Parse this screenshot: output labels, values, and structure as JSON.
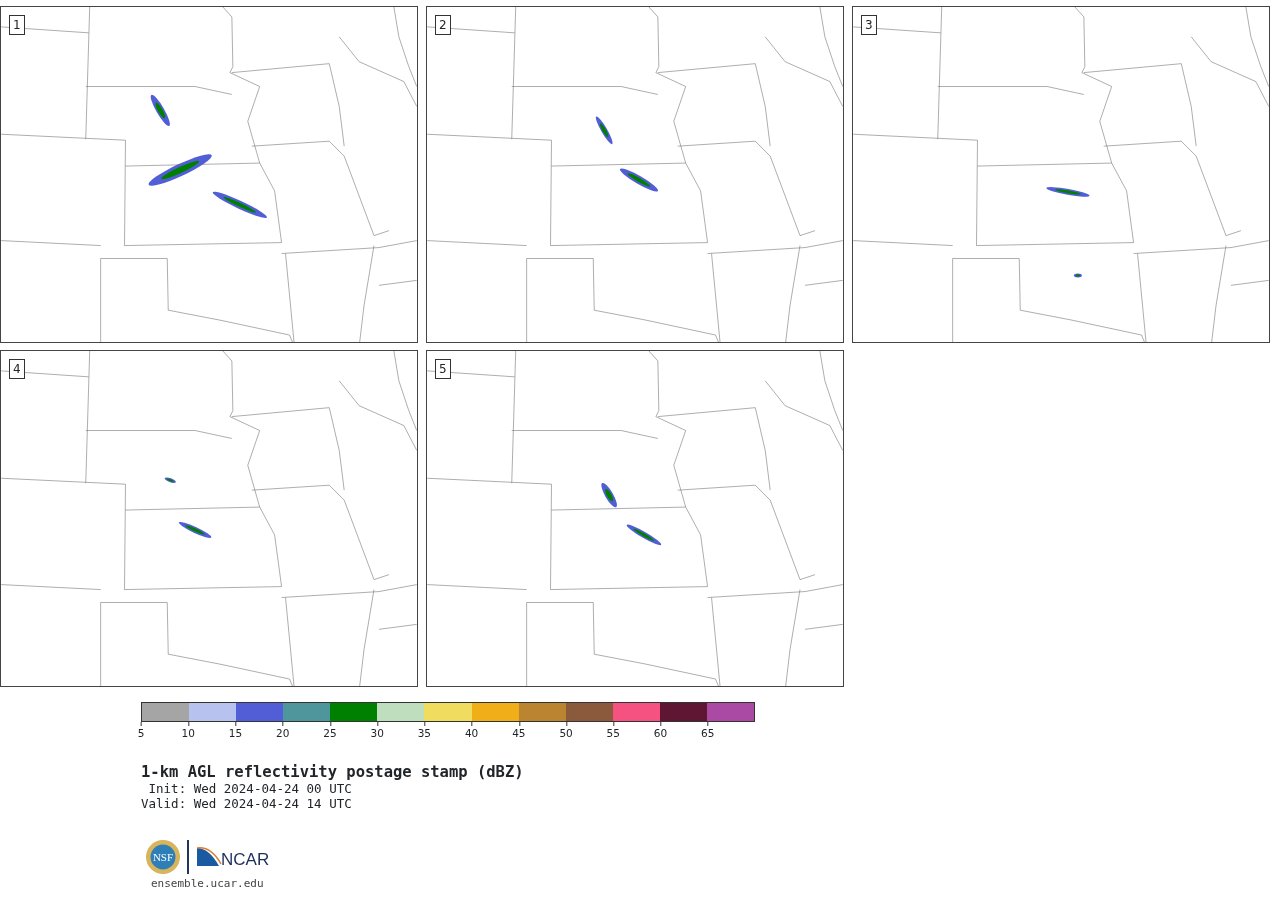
{
  "panels": [
    {
      "label": "1"
    },
    {
      "label": "2"
    },
    {
      "label": "3"
    },
    {
      "label": "4"
    },
    {
      "label": "5"
    }
  ],
  "colorbar": {
    "bins": [
      {
        "color": "#a5a5a5"
      },
      {
        "color": "#b7c3ee"
      },
      {
        "color": "#525ed5"
      },
      {
        "color": "#4e969c"
      },
      {
        "color": "#008000"
      },
      {
        "color": "#bedebe"
      },
      {
        "color": "#f0dc5e"
      },
      {
        "color": "#f0ae18"
      },
      {
        "color": "#bb8430"
      },
      {
        "color": "#8b5a3c"
      },
      {
        "color": "#f65281"
      },
      {
        "color": "#5f1633"
      },
      {
        "color": "#ab4aa5"
      }
    ],
    "ticks": [
      "5",
      "10",
      "15",
      "20",
      "25",
      "30",
      "35",
      "40",
      "45",
      "50",
      "55",
      "60",
      "65"
    ]
  },
  "title": "1-km AGL reflectivity postage stamp (dBZ)",
  "init": " Init: Wed 2024-04-24 00 UTC",
  "valid": "Valid: Wed 2024-04-24 14 UTC",
  "logo": {
    "nsf": "NSF",
    "ncar": "NCAR"
  },
  "url": "ensemble.ucar.edu"
}
